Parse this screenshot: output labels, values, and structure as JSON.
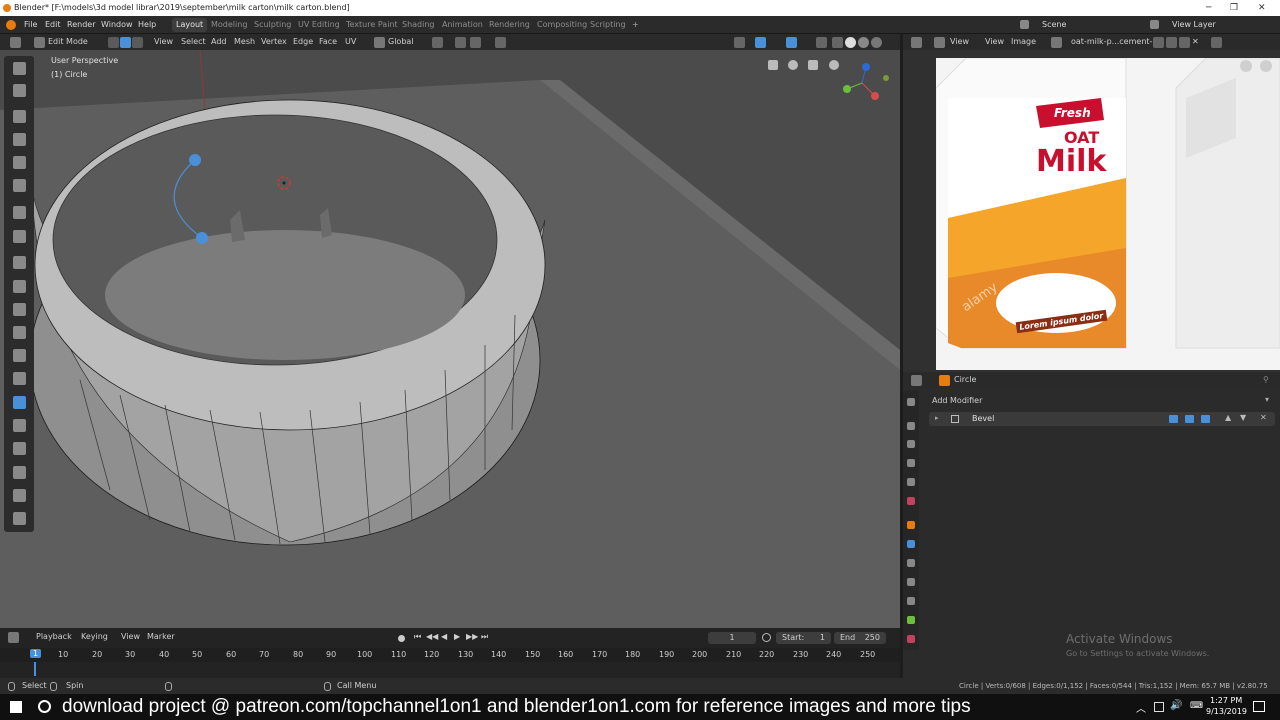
{
  "window": {
    "title": "Blender* [F:\\models\\3d model librar\\2019\\september\\milk carton\\milk carton.blend]"
  },
  "menu": {
    "items": [
      "File",
      "Edit",
      "Render",
      "Window",
      "Help"
    ]
  },
  "workspaces": [
    "Layout",
    "Modeling",
    "Sculpting",
    "UV Editing",
    "Texture Paint",
    "Shading",
    "Animation",
    "Rendering",
    "Compositing",
    "Scripting"
  ],
  "scene": {
    "label": "Scene",
    "view_layer": "View Layer"
  },
  "header3d": {
    "mode": "Edit Mode",
    "menus": [
      "View",
      "Select",
      "Add",
      "Mesh",
      "Vertex",
      "Edge",
      "Face",
      "UV"
    ],
    "orientation": "Global"
  },
  "viewport": {
    "perspective": "User Perspective",
    "object": "(1) Circle"
  },
  "image_editor": {
    "menus": [
      "View",
      "View",
      "Image"
    ],
    "image_name": "oat-milk-p...cement-m"
  },
  "carton": {
    "brand": "Fresh",
    "line1": "OAT",
    "line2": "Milk",
    "tag": "Lorem ipsum dolor",
    "watermark": "alamy"
  },
  "properties": {
    "object": "Circle",
    "add_modifier": "Add Modifier",
    "modifier": "Bevel"
  },
  "timeline": {
    "menus": [
      "Playback",
      "Keying",
      "View",
      "Marker"
    ],
    "current": "1",
    "start_label": "Start:",
    "start": "1",
    "end_label": "End",
    "end": "250",
    "frames": [
      "1",
      "10",
      "20",
      "30",
      "40",
      "50",
      "60",
      "70",
      "80",
      "90",
      "100",
      "110",
      "120",
      "130",
      "140",
      "150",
      "160",
      "170",
      "180",
      "190",
      "200",
      "210",
      "220",
      "230",
      "240",
      "250"
    ]
  },
  "statusbar": {
    "select": "Select",
    "spin": "Spin",
    "call_menu": "Call Menu",
    "stats": "Circle | Verts:0/608 | Edges:0/1,152 | Faces:0/544 | Tris:1,152 | Mem: 65.7 MB | v2.80.75"
  },
  "watermark": {
    "line1": "Activate Windows",
    "line2": "Go to Settings to activate Windows."
  },
  "banner": "download project @ patreon.com/topchannel1on1  and blender1on1.com for reference images and more tips",
  "clock": {
    "time": "1:27 PM",
    "date": "9/13/2019"
  },
  "colors": {
    "accent": "#4a90d9",
    "active_tab": "#3d3d3d",
    "viewport_bg": "#4b4b4b"
  }
}
